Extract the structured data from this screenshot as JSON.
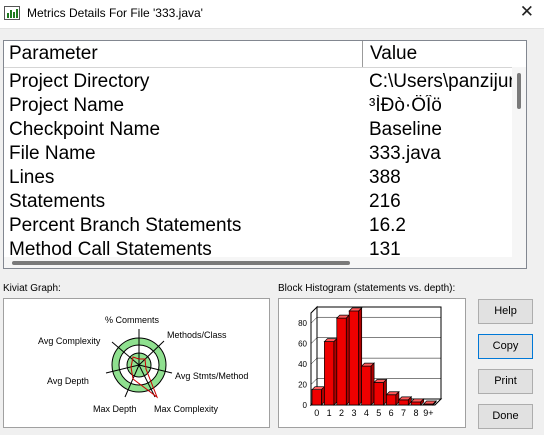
{
  "window": {
    "title": "Metrics Details For File '333.java'"
  },
  "table": {
    "headers": [
      "Parameter",
      "Value"
    ],
    "rows": [
      [
        "Project Directory",
        "C:\\Users\\panzijun"
      ],
      [
        "Project Name",
        "³ÌÐò·ÖÎö"
      ],
      [
        "Checkpoint Name",
        "Baseline"
      ],
      [
        "File Name",
        "333.java"
      ],
      [
        "Lines",
        "388"
      ],
      [
        "Statements",
        "216"
      ],
      [
        "Percent Branch Statements",
        "16.2"
      ],
      [
        "Method Call Statements",
        "131"
      ]
    ]
  },
  "kiviat": {
    "label": "Kiviat Graph:",
    "axes": [
      "% Comments",
      "Methods/Class",
      "Avg Stmts/Method",
      "Max Complexity",
      "Max Depth",
      "Avg Depth",
      "Avg Complexity"
    ]
  },
  "chart_data": {
    "type": "bar",
    "title": "Block Histogram (statements vs. depth):",
    "categories": [
      "0",
      "1",
      "2",
      "3",
      "4",
      "5",
      "6",
      "7",
      "8",
      "9+"
    ],
    "values": [
      15,
      62,
      85,
      92,
      38,
      22,
      10,
      5,
      3,
      1
    ],
    "ylim": [
      0,
      90
    ],
    "yticks": [
      0,
      20,
      40,
      60,
      80
    ],
    "bar_color": "#ee0000"
  },
  "buttons": {
    "help": "Help",
    "copy": "Copy",
    "print": "Print",
    "done": "Done"
  }
}
